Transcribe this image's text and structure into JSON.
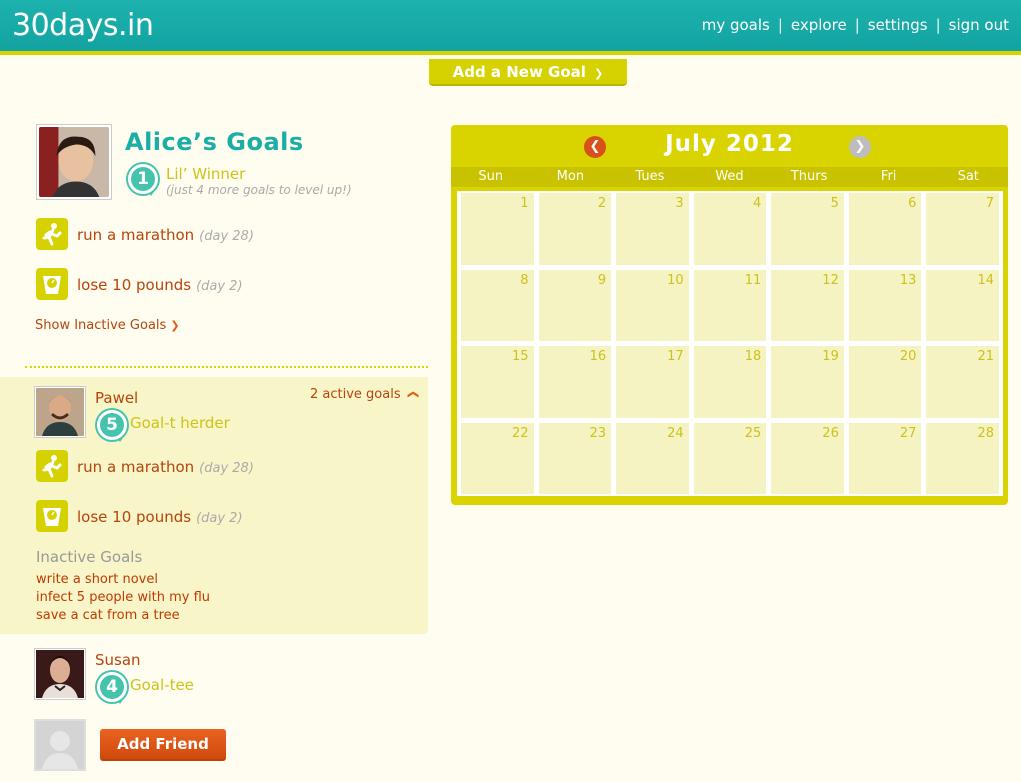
{
  "header": {
    "logo": "30days.in",
    "nav": [
      {
        "label": "my goals"
      },
      {
        "label": "explore"
      },
      {
        "label": "settings"
      },
      {
        "label": "sign out"
      }
    ]
  },
  "add_goal_button": "Add a New Goal",
  "user": {
    "title": "Alice’s Goals",
    "level": "1",
    "rank": "Lil’ Winner",
    "level_hint": "(just 4 more goals to level up!)",
    "goals": [
      {
        "name": "run a marathon",
        "day": "(day 28)",
        "icon": "runner-icon"
      },
      {
        "name": "lose 10 pounds",
        "day": "(day 2)",
        "icon": "scale-icon"
      }
    ],
    "show_inactive": "Show Inactive Goals"
  },
  "friends": [
    {
      "name": "Pawel",
      "level": "5",
      "rank": "Goal-t herder",
      "active_count": "2 active goals",
      "goals": [
        {
          "name": "run a marathon",
          "day": "(day 28)",
          "icon": "runner-icon"
        },
        {
          "name": "lose 10 pounds",
          "day": "(day 2)",
          "icon": "scale-icon"
        }
      ],
      "inactive_title": "Inactive Goals",
      "inactive_goals": [
        "write a short novel",
        "infect 5 people with my flu",
        "save a cat from a tree"
      ]
    },
    {
      "name": "Susan",
      "level": "4",
      "rank": "Goal-tee"
    }
  ],
  "add_friend_button": "Add Friend",
  "calendar": {
    "month": "July 2012",
    "weekdays": [
      "Sun",
      "Mon",
      "Tues",
      "Wed",
      "Thurs",
      "Fri",
      "Sat"
    ],
    "days": [
      "1",
      "2",
      "3",
      "4",
      "5",
      "6",
      "7",
      "8",
      "9",
      "10",
      "11",
      "12",
      "13",
      "14",
      "15",
      "16",
      "17",
      "18",
      "19",
      "20",
      "21",
      "22",
      "23",
      "24",
      "25",
      "26",
      "27",
      "28"
    ]
  },
  "colors": {
    "teal": "#15a8a5",
    "yellow": "#d9d400",
    "orange": "#e15a12",
    "badge": "#46c3ad"
  }
}
